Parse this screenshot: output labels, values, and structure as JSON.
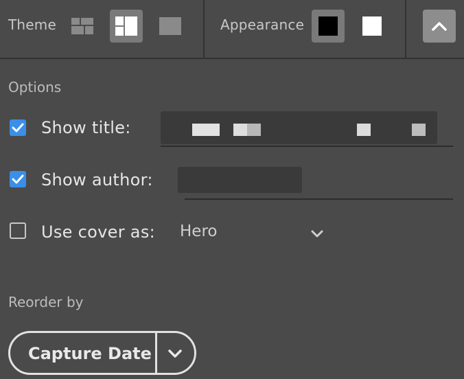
{
  "toolbar": {
    "theme_label": "Theme",
    "theme_options": [
      "grid-icon",
      "split-layout-icon",
      "single-block-icon"
    ],
    "theme_selected": "split-layout-icon",
    "appearance_label": "Appearance",
    "appearance_options": [
      "dark-swatch",
      "light-swatch"
    ],
    "appearance_selected": "dark-swatch",
    "collapse_icon": "chevron-up-icon"
  },
  "options": {
    "heading": "Options",
    "show_title": {
      "label": "Show title:",
      "checked": true
    },
    "show_author": {
      "label": "Show author:",
      "checked": true
    },
    "use_cover": {
      "label": "Use cover as:",
      "checked": false,
      "value": "Hero"
    }
  },
  "reorder": {
    "heading": "Reorder by",
    "value": "Capture Date"
  },
  "colors": {
    "background": "#4a4a4a",
    "accent": "#3a8fe8",
    "button_active": "#7a7a7a"
  }
}
